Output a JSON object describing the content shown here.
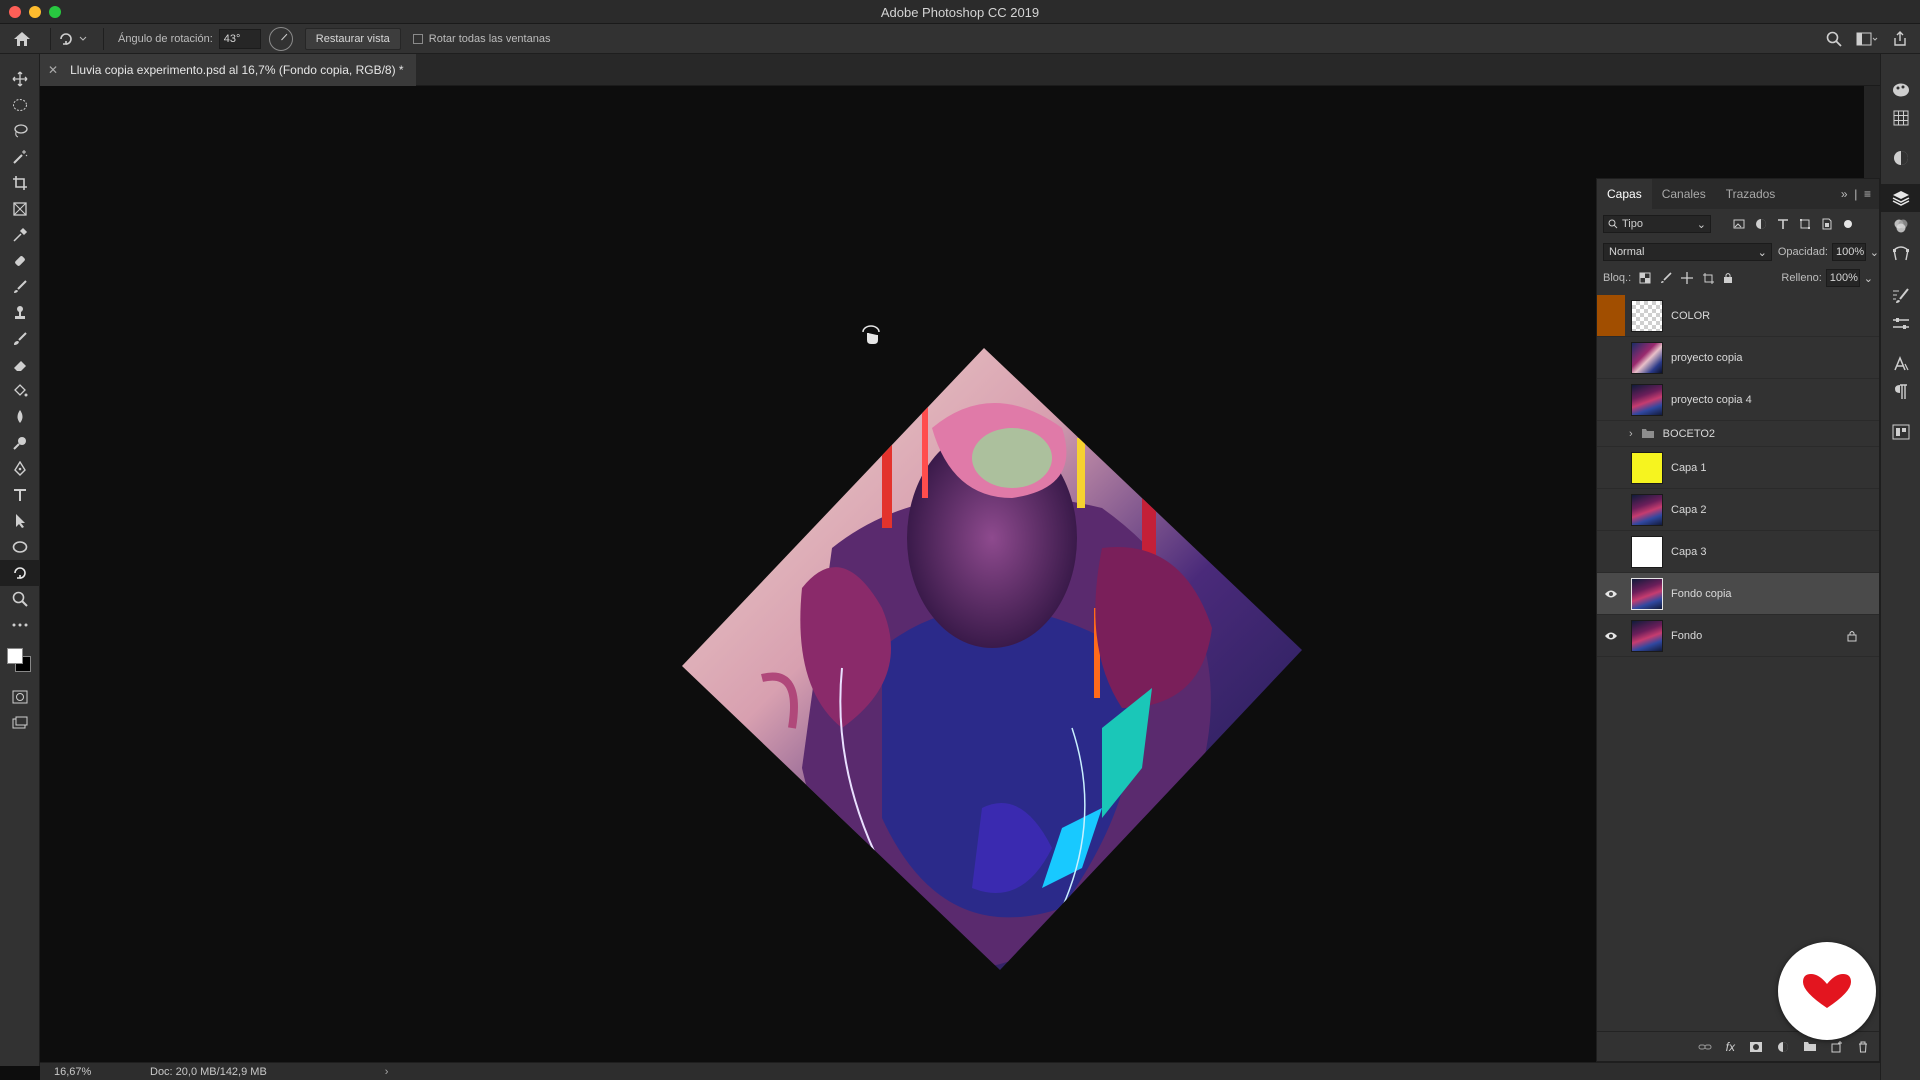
{
  "window": {
    "title": "Adobe Photoshop CC 2019"
  },
  "options_bar": {
    "rotation_label": "Ángulo de rotación:",
    "rotation_value": "43°",
    "restore_view_label": "Restaurar vista",
    "rotate_all_label": "Rotar todas las ventanas",
    "rotate_all_checked": false
  },
  "document": {
    "tab_title": "Lluvia copia experimento.psd al 16,7% (Fondo copia, RGB/8) *",
    "rotation_degrees": 43
  },
  "status_bar": {
    "zoom": "16,67%",
    "doc_info": "Doc: 20,0 MB/142,9 MB"
  },
  "layers_panel": {
    "tabs": [
      {
        "label": "Capas",
        "active": true
      },
      {
        "label": "Canales",
        "active": false
      },
      {
        "label": "Trazados",
        "active": false
      }
    ],
    "filter_type": "Tipo",
    "blend_mode": "Normal",
    "opacity_label": "Opacidad:",
    "opacity_value": "100%",
    "lock_label": "Bloq.:",
    "fill_label": "Relleno:",
    "fill_value": "100%",
    "layers": [
      {
        "name": "COLOR",
        "visible": false,
        "thumb": "checker",
        "color_tag": "#a14e00",
        "selected": false,
        "locked": false
      },
      {
        "name": "proyecto copia",
        "visible": false,
        "thumb": "photo",
        "selected": false,
        "locked": false
      },
      {
        "name": "proyecto copia 4",
        "visible": false,
        "thumb": "photo2",
        "selected": false,
        "locked": false
      },
      {
        "name": "BOCETO2",
        "visible": false,
        "thumb": "folder",
        "group": true,
        "selected": false,
        "locked": false
      },
      {
        "name": "Capa 1",
        "visible": false,
        "thumb": "yellow",
        "selected": false,
        "locked": false
      },
      {
        "name": "Capa 2",
        "visible": false,
        "thumb": "photo2",
        "selected": false,
        "locked": false
      },
      {
        "name": "Capa 3",
        "visible": false,
        "thumb": "white",
        "selected": false,
        "locked": false
      },
      {
        "name": "Fondo copia",
        "visible": true,
        "thumb": "photo2",
        "selected": true,
        "locked": false
      },
      {
        "name": "Fondo",
        "visible": true,
        "thumb": "photo2",
        "selected": false,
        "locked": true
      }
    ]
  },
  "icons": {
    "toolbox": [
      "move-icon",
      "marquee-icon",
      "lasso-icon",
      "magic-wand-icon",
      "crop-icon",
      "frame-icon",
      "eyedropper-icon",
      "healing-brush-icon",
      "brush-icon",
      "clone-stamp-icon",
      "history-brush-icon",
      "eraser-icon",
      "paint-bucket-icon",
      "blur-icon",
      "dodge-icon",
      "pen-icon",
      "type-icon",
      "path-selection-icon",
      "ellipse-icon",
      "rotate-view-icon",
      "zoom-icon",
      "more-tools-icon"
    ]
  },
  "colors": {
    "accent_badge": "#e3151f",
    "selected_layer_bg": "#4a4a4a",
    "foreground": "#ffffff",
    "background": "#000000"
  }
}
